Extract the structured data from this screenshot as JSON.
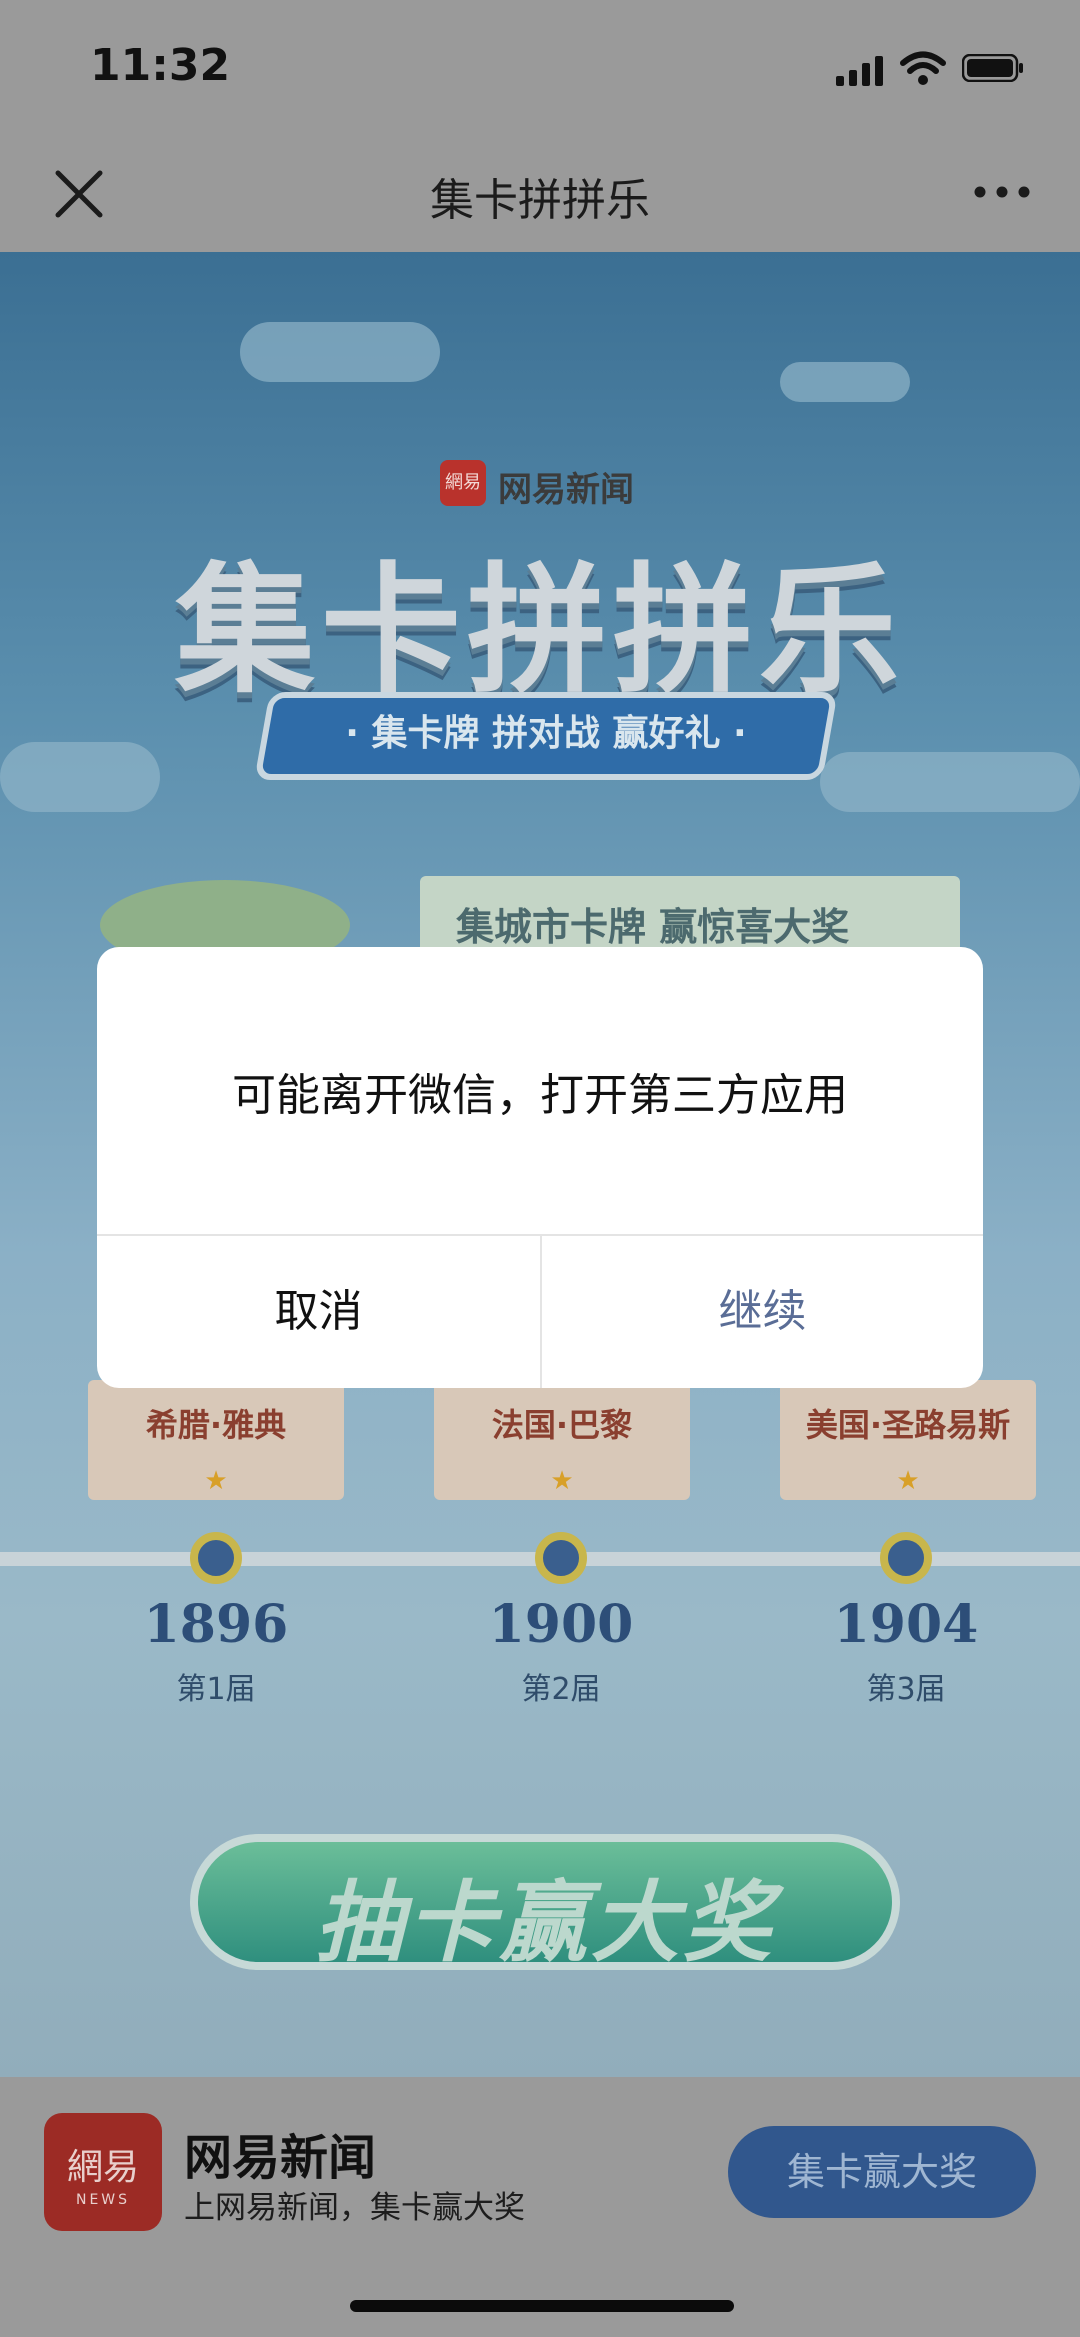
{
  "status_bar": {
    "time": "11:32"
  },
  "nav": {
    "title": "集卡拼拼乐"
  },
  "hero": {
    "brand": "网易新闻",
    "brand_badge": "網易",
    "title": "集卡拼拼乐",
    "subtitle": "· 集卡牌 拼对战 赢好礼 ·",
    "ribbon": "集城市卡牌 赢惊喜大奖"
  },
  "timeline": [
    {
      "city": "希腊·雅典",
      "year": "1896",
      "edition": "第1届"
    },
    {
      "city": "法国·巴黎",
      "year": "1900",
      "edition": "第2届"
    },
    {
      "city": "美国·圣路易斯",
      "year": "1904",
      "edition": "第3届"
    }
  ],
  "draw_button": "抽卡赢大奖",
  "bottom_bar": {
    "logo_text": "網易",
    "logo_sub": "NEWS",
    "app_name": "网易新闻",
    "tagline": "上网易新闻，集卡赢大奖",
    "cta": "集卡赢大奖"
  },
  "dialog": {
    "message": "可能离开微信，打开第三方应用",
    "cancel": "取消",
    "continue": "继续"
  },
  "colors": {
    "accent_link": "#5a6d96",
    "cta_blue": "#31578d",
    "overlay_dim": "#9a9a9a"
  }
}
